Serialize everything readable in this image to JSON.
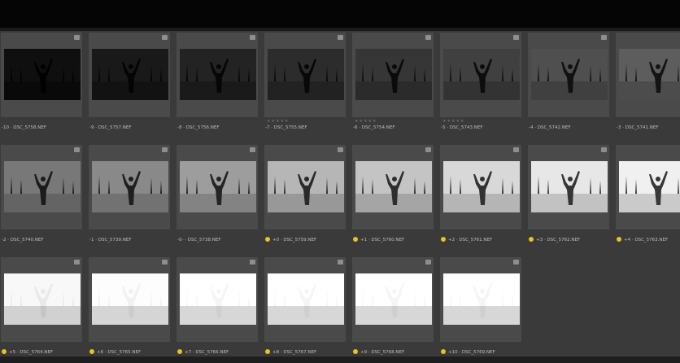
{
  "bracketed_strip": {
    "frames": [
      {
        "label": "-10 · DSC_5758.NEF",
        "rating_dot": false,
        "stars": "",
        "brightness": 0.02
      },
      {
        "label": "-9 · DSC_5757.NEF",
        "rating_dot": false,
        "stars": "",
        "brightness": 0.06
      },
      {
        "label": "-8 · DSC_5756.NEF",
        "rating_dot": false,
        "stars": "",
        "brightness": 0.1
      },
      {
        "label": "-7 · DSC_5755.NEF",
        "rating_dot": false,
        "stars": "★★★★★",
        "brightness": 0.14
      },
      {
        "label": "-6 · DSC_5754.NEF",
        "rating_dot": false,
        "stars": "★★★★★",
        "brightness": 0.18
      },
      {
        "label": "-5 · DSC_5743.NEF",
        "rating_dot": false,
        "stars": "★★★★★",
        "brightness": 0.22
      },
      {
        "label": "-4 · DSC_5742.NEF",
        "rating_dot": false,
        "stars": "",
        "brightness": 0.28
      },
      {
        "label": "-3 · DSC_5741.NEF",
        "rating_dot": false,
        "stars": "",
        "brightness": 0.34
      },
      {
        "label": "-2 · DSC_5740.NEF",
        "rating_dot": false,
        "stars": "",
        "brightness": 0.45
      },
      {
        "label": "-1 · DSC_5739.NEF",
        "rating_dot": false,
        "stars": "",
        "brightness": 0.52
      },
      {
        "label": "-0- · DSC_5738.NEF",
        "rating_dot": false,
        "stars": "",
        "brightness": 0.6
      },
      {
        "label": "+0 · DSC_5759.NEF",
        "rating_dot": true,
        "stars": "",
        "brightness": 0.7
      },
      {
        "label": "+1 · DSC_5760.NEF",
        "rating_dot": true,
        "stars": "",
        "brightness": 0.76
      },
      {
        "label": "+2 · DSC_5761.NEF",
        "rating_dot": true,
        "stars": "",
        "brightness": 0.84
      },
      {
        "label": "+3 · DSC_5762.NEF",
        "rating_dot": true,
        "stars": "",
        "brightness": 0.9
      },
      {
        "label": "+4 · DSC_5763.NEF",
        "rating_dot": true,
        "stars": "",
        "brightness": 0.94
      },
      {
        "label": "+5 · DSC_5764.NEF",
        "rating_dot": true,
        "stars": "",
        "brightness": 0.97
      },
      {
        "label": "+6 · DSC_5765.NEF",
        "rating_dot": true,
        "stars": "",
        "brightness": 0.99
      },
      {
        "label": "+7 · DSC_5766.NEF",
        "rating_dot": true,
        "stars": "",
        "brightness": 1.0
      },
      {
        "label": "+8 · DSC_5767.NEF",
        "rating_dot": true,
        "stars": "",
        "brightness": 1.0
      },
      {
        "label": "+9 · DSC_5768.NEF",
        "rating_dot": true,
        "stars": "",
        "brightness": 1.0
      },
      {
        "label": "+10 · DSC_5769.NEF",
        "rating_dot": true,
        "stars": "",
        "brightness": 1.0
      }
    ]
  },
  "colors": {
    "background": "#3a3a3a",
    "card": "#4a4a4a",
    "rating_dot": "#e6c12a",
    "label_text": "#bdbdbd"
  },
  "icons": {
    "badge": "raw-file-badge-icon",
    "dot": "color-label-dot-icon"
  }
}
